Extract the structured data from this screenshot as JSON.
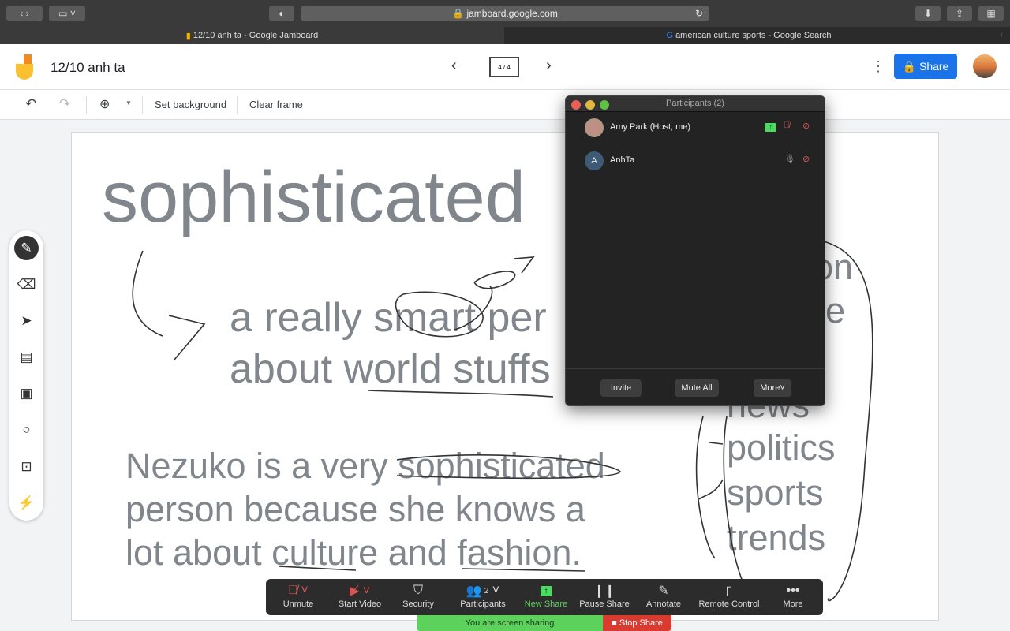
{
  "browser": {
    "url": "jamboard.google.com",
    "tabs": [
      {
        "label": "12/10 anh ta - Google Jamboard",
        "active": true
      },
      {
        "label": "american culture sports - Google Search",
        "active": false
      }
    ]
  },
  "app": {
    "title": "12/10 anh ta",
    "frame_counter": "4 / 4",
    "share_label": "Share",
    "accent": "#1a73e8"
  },
  "toolbar": {
    "set_background": "Set background",
    "clear_frame": "Clear frame"
  },
  "canvas": {
    "heading": "sophisticated",
    "definition": [
      "a really smart per",
      "about world stuffs"
    ],
    "sentence": [
      "Nezuko is a very sophisticated",
      "person because she knows a",
      "lot about culture and fashion."
    ],
    "list_partial": [
      "on",
      "e"
    ],
    "list": [
      "news",
      "politics",
      "sports",
      "trends"
    ]
  },
  "participants": {
    "title": "Participants (2)",
    "people": [
      {
        "name": "Amy Park (Host, me)",
        "initial": ""
      },
      {
        "name": "AnhTa",
        "initial": "A"
      }
    ],
    "invite": "Invite",
    "mute_all": "Mute All",
    "more": "More"
  },
  "zoom_bar": {
    "items": [
      "Unmute",
      "Start Video",
      "Security",
      "Participants",
      "New Share",
      "Pause Share",
      "Annotate",
      "Remote Control",
      "More"
    ],
    "participant_count": "2"
  },
  "share_bar": {
    "status": "You are screen sharing",
    "stop": "Stop Share"
  }
}
